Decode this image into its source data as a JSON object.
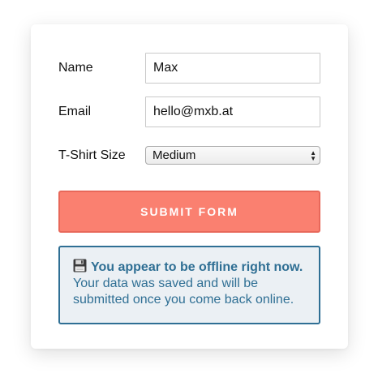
{
  "form": {
    "name_label": "Name",
    "name_value": "Max",
    "email_label": "Email",
    "email_value": "hello@mxb.at",
    "size_label": "T-Shirt Size",
    "size_value": "Medium",
    "submit_label": "Submit Form"
  },
  "notice": {
    "icon": "floppy-disk-icon",
    "title": "You appear to be offline right now.",
    "message": "Your data was saved and will be submitted once you come back online."
  },
  "colors": {
    "submit_bg": "#fa8070",
    "notice_border": "#2f6f94",
    "notice_bg": "#ebf0f4"
  }
}
